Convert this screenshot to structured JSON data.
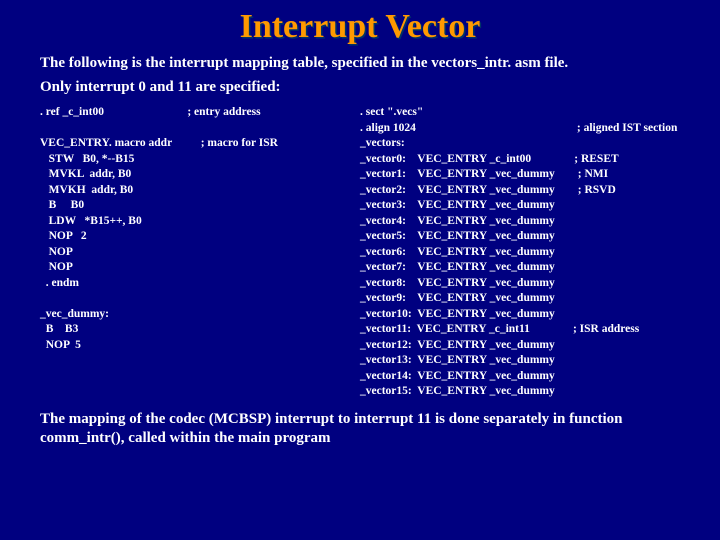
{
  "title": "Interrupt Vector",
  "intro1": "The following is the interrupt mapping table, specified in the vectors_intr. asm file.",
  "intro2": "Only interrupt 0 and 11 are specified:",
  "left_code": ". ref _c_int00                             ; entry address\n\nVEC_ENTRY. macro addr          ; macro for ISR\n   STW   B0, *--B15\n   MVKL  addr, B0\n   MVKH  addr, B0\n   B     B0\n   LDW   *B15++, B0\n   NOP   2\n   NOP\n   NOP\n  . endm\n\n_vec_dummy:\n  B    B3\n  NOP  5",
  "right_code": ". sect \".vecs\"\n. align 1024                                                        ; aligned IST section\n_vectors:\n_vector0:    VEC_ENTRY _c_int00               ; RESET\n_vector1:    VEC_ENTRY _vec_dummy        ; NMI\n_vector2:    VEC_ENTRY _vec_dummy        ; RSVD\n_vector3:    VEC_ENTRY _vec_dummy\n_vector4:    VEC_ENTRY _vec_dummy\n_vector5:    VEC_ENTRY _vec_dummy\n_vector6:    VEC_ENTRY _vec_dummy\n_vector7:    VEC_ENTRY _vec_dummy\n_vector8:    VEC_ENTRY _vec_dummy\n_vector9:    VEC_ENTRY _vec_dummy\n_vector10:  VEC_ENTRY _vec_dummy\n_vector11:  VEC_ENTRY _c_int11               ; ISR address\n_vector12:  VEC_ENTRY _vec_dummy\n_vector13:  VEC_ENTRY _vec_dummy\n_vector14:  VEC_ENTRY _vec_dummy\n_vector15:  VEC_ENTRY _vec_dummy",
  "footer": "The mapping of the codec (MCBSP) interrupt to interrupt 11 is done separately in function  comm_intr(), called within the main program"
}
